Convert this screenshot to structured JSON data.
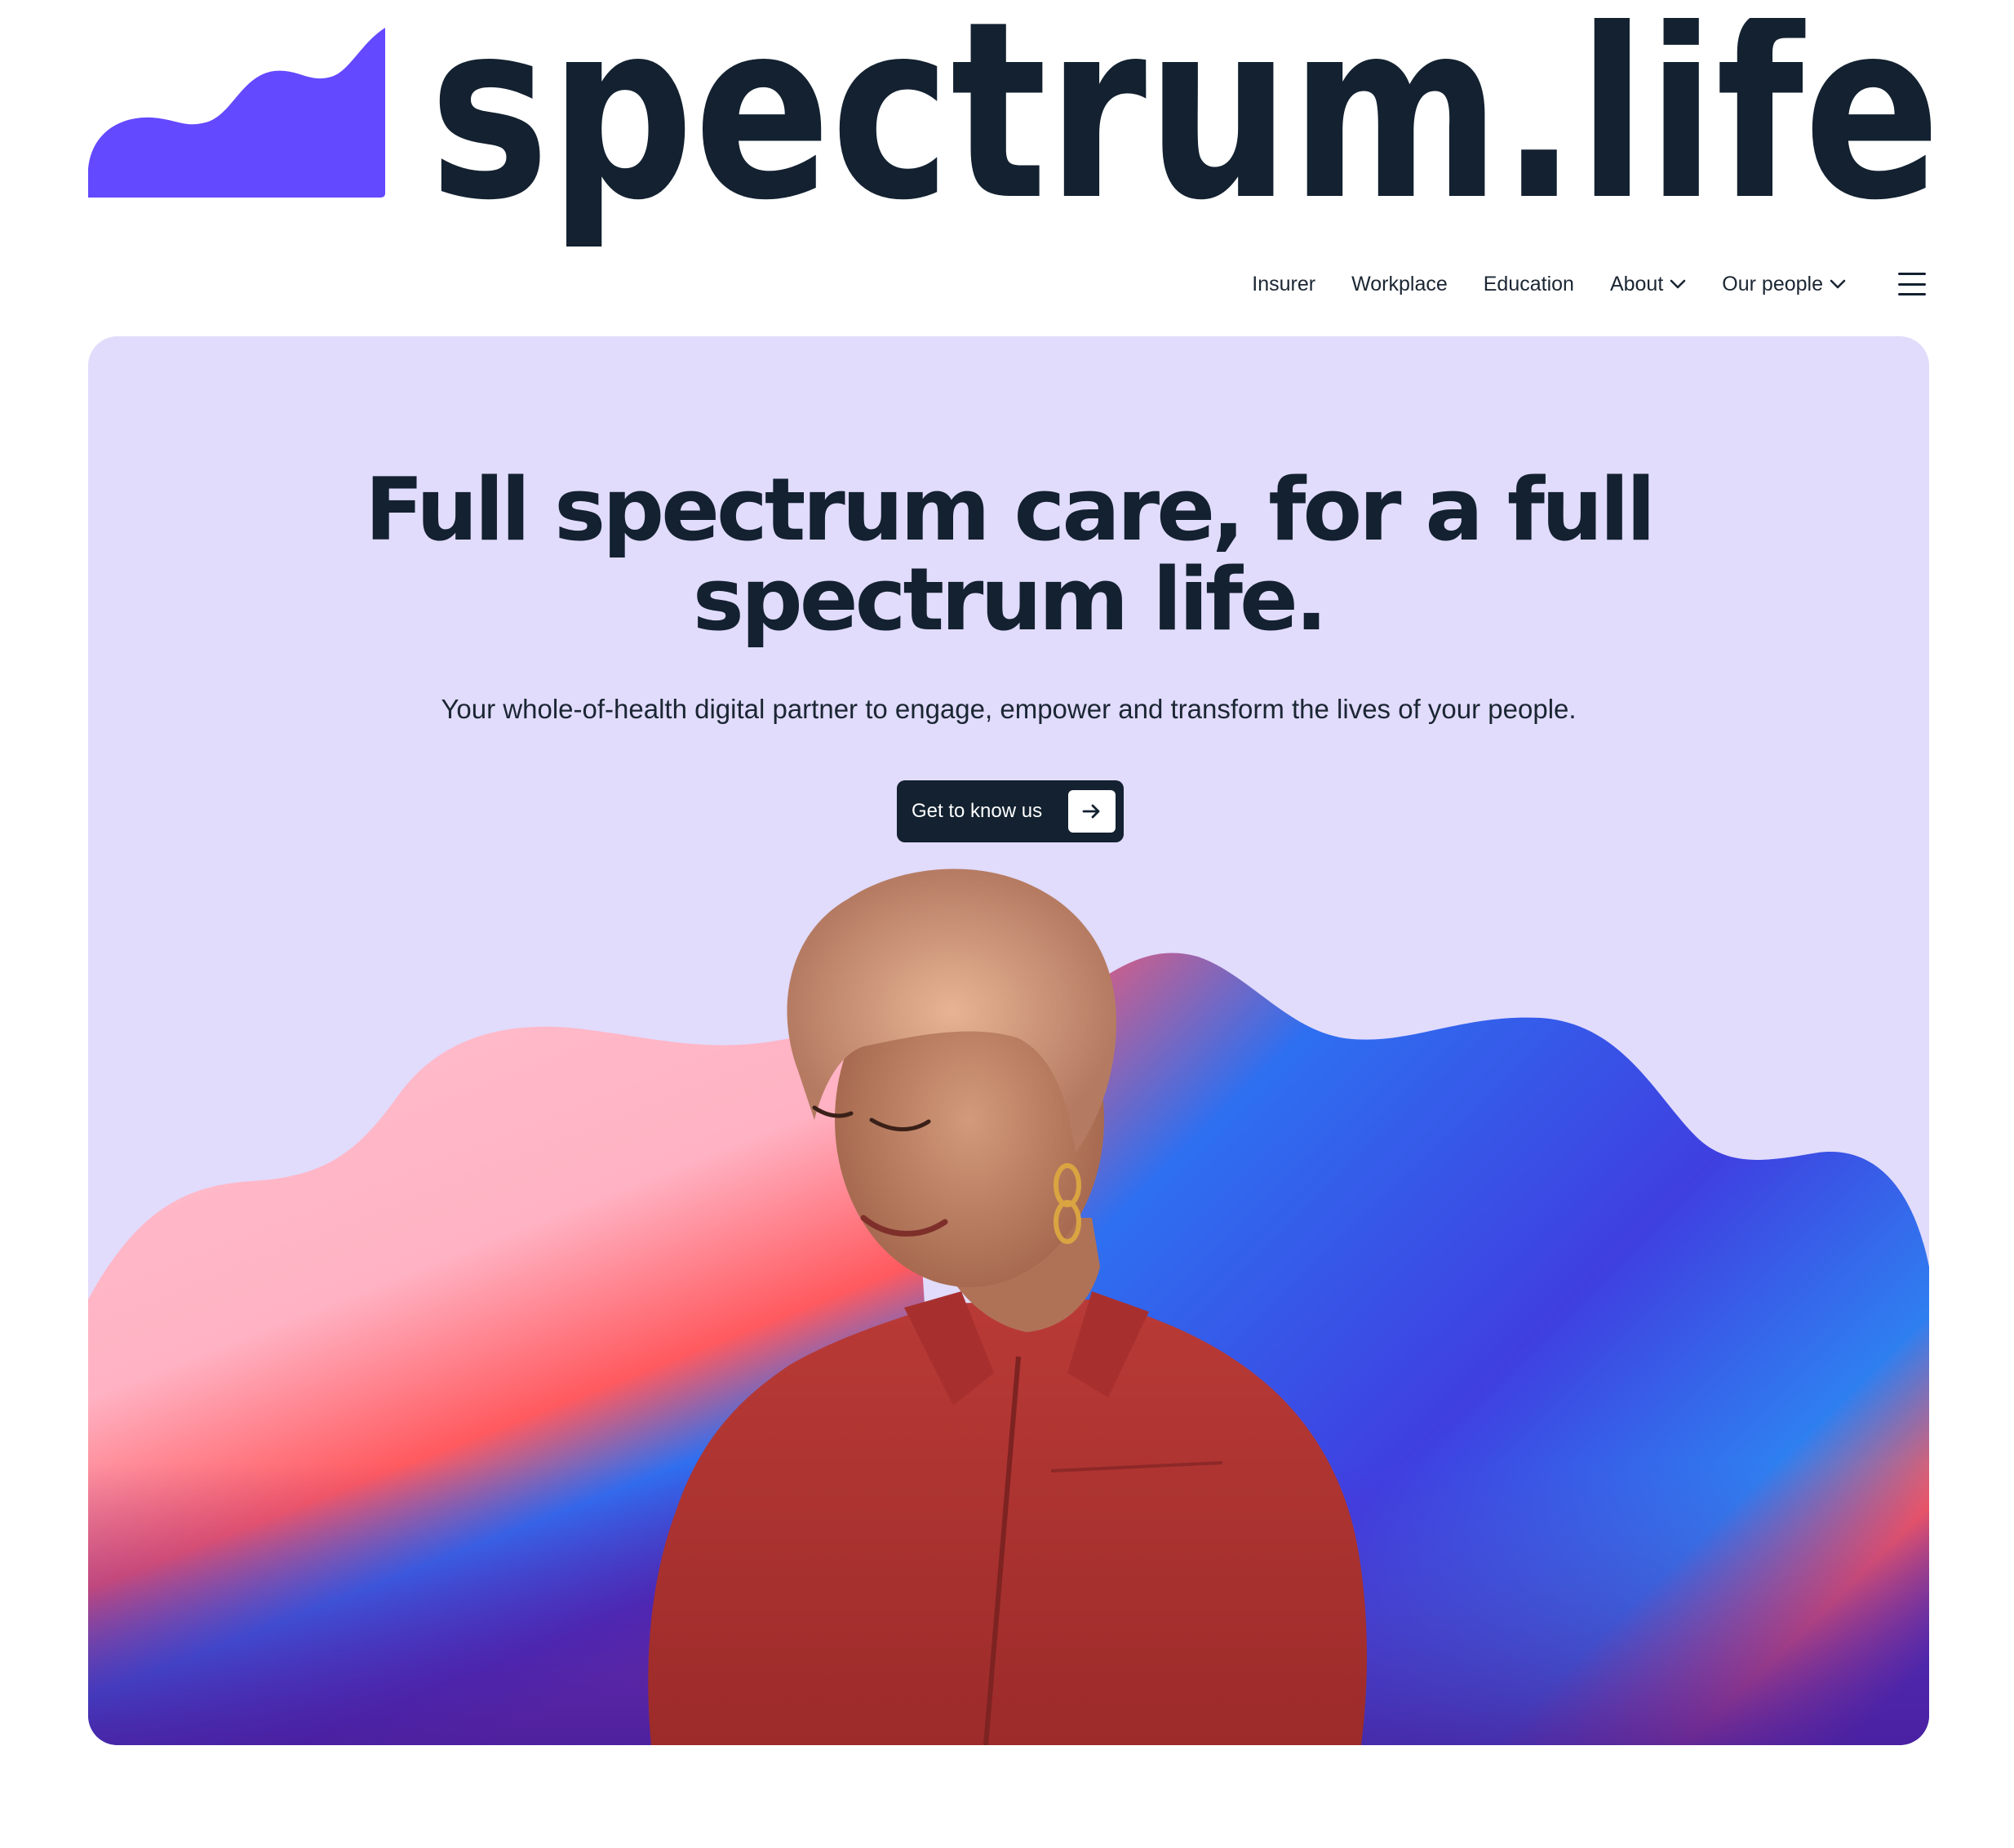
{
  "brand": {
    "wordmark": "spectrum.life",
    "logo_color": "#6349FF",
    "text_color": "#132130"
  },
  "nav": {
    "items": [
      {
        "label": "Insurer",
        "has_dropdown": false
      },
      {
        "label": "Workplace",
        "has_dropdown": false
      },
      {
        "label": "Education",
        "has_dropdown": false
      },
      {
        "label": "About",
        "has_dropdown": true
      },
      {
        "label": "Our people",
        "has_dropdown": true
      }
    ],
    "menu_icon": "hamburger-menu-icon"
  },
  "hero": {
    "title_line1": "Full spectrum care, for a full",
    "title_line2": "spectrum life.",
    "subtitle": "Your whole-of-health digital partner to engage, empower and transform the lives of your people.",
    "cta_label": "Get to know us",
    "cta_icon": "arrow-right-icon",
    "background_color": "#E1DBFC",
    "image": "smiling-person-red-jacket-photo"
  }
}
